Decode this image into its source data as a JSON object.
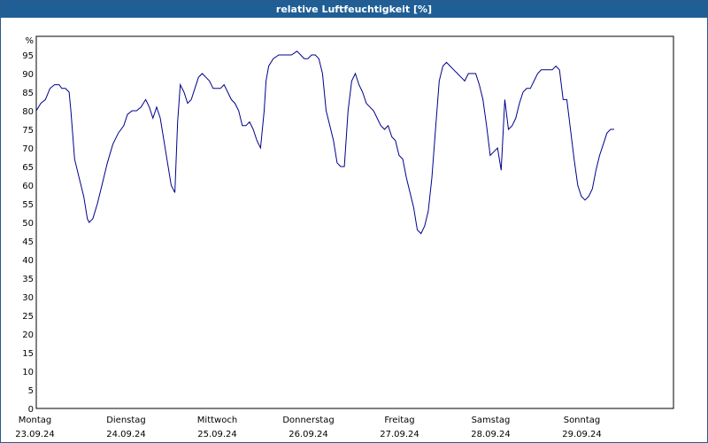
{
  "window": {
    "title": "relative Luftfeuchtigkeit [%]"
  },
  "chart_data": {
    "type": "line",
    "title": "relative Luftfeuchtigkeit [%]",
    "ylabel": "%",
    "xlabel": "",
    "ylim": [
      0,
      100
    ],
    "yticks": [
      0,
      5,
      10,
      15,
      20,
      25,
      30,
      35,
      40,
      45,
      50,
      55,
      60,
      65,
      70,
      75,
      80,
      85,
      90,
      95
    ],
    "grid": true,
    "line_color": "#00008b",
    "grid_color": "#000000",
    "xrange_days": [
      0,
      7
    ],
    "day_labels": [
      {
        "day": "Montag",
        "date": "23.09.24"
      },
      {
        "day": "Dienstag",
        "date": "24.09.24"
      },
      {
        "day": "Mittwoch",
        "date": "25.09.24"
      },
      {
        "day": "Donnerstag",
        "date": "26.09.24"
      },
      {
        "day": "Freitag",
        "date": "27.09.24"
      },
      {
        "day": "Samstag",
        "date": "28.09.24"
      },
      {
        "day": "Sonntag",
        "date": "29.09.24"
      }
    ],
    "series": [
      {
        "values": [
          [
            0.0,
            80
          ],
          [
            0.05,
            82
          ],
          [
            0.1,
            83
          ],
          [
            0.15,
            86
          ],
          [
            0.2,
            87
          ],
          [
            0.25,
            87
          ],
          [
            0.28,
            86
          ],
          [
            0.32,
            86
          ],
          [
            0.36,
            85
          ],
          [
            0.38,
            80
          ],
          [
            0.42,
            67
          ],
          [
            0.47,
            62
          ],
          [
            0.52,
            57
          ],
          [
            0.56,
            51
          ],
          [
            0.58,
            50
          ],
          [
            0.62,
            51
          ],
          [
            0.67,
            55
          ],
          [
            0.72,
            60
          ],
          [
            0.78,
            66
          ],
          [
            0.84,
            71
          ],
          [
            0.9,
            74
          ],
          [
            0.96,
            76
          ],
          [
            1.0,
            79
          ],
          [
            1.05,
            80
          ],
          [
            1.1,
            80
          ],
          [
            1.15,
            81
          ],
          [
            1.2,
            83
          ],
          [
            1.24,
            81
          ],
          [
            1.28,
            78
          ],
          [
            1.32,
            81
          ],
          [
            1.36,
            78
          ],
          [
            1.4,
            72
          ],
          [
            1.44,
            66
          ],
          [
            1.48,
            60
          ],
          [
            1.52,
            58
          ],
          [
            1.55,
            77
          ],
          [
            1.58,
            87
          ],
          [
            1.62,
            85
          ],
          [
            1.66,
            82
          ],
          [
            1.7,
            83
          ],
          [
            1.74,
            86
          ],
          [
            1.78,
            89
          ],
          [
            1.82,
            90
          ],
          [
            1.86,
            89
          ],
          [
            1.9,
            88
          ],
          [
            1.94,
            86
          ],
          [
            1.98,
            86
          ],
          [
            2.02,
            86
          ],
          [
            2.06,
            87
          ],
          [
            2.1,
            85
          ],
          [
            2.14,
            83
          ],
          [
            2.18,
            82
          ],
          [
            2.22,
            80
          ],
          [
            2.26,
            76
          ],
          [
            2.3,
            76
          ],
          [
            2.34,
            77
          ],
          [
            2.38,
            75
          ],
          [
            2.42,
            72
          ],
          [
            2.46,
            70
          ],
          [
            2.5,
            80
          ],
          [
            2.52,
            88
          ],
          [
            2.55,
            92
          ],
          [
            2.6,
            94
          ],
          [
            2.66,
            95
          ],
          [
            2.72,
            95
          ],
          [
            2.8,
            95
          ],
          [
            2.86,
            96
          ],
          [
            2.9,
            95
          ],
          [
            2.94,
            94
          ],
          [
            2.98,
            94
          ],
          [
            3.02,
            95
          ],
          [
            3.06,
            95
          ],
          [
            3.1,
            94
          ],
          [
            3.14,
            90
          ],
          [
            3.18,
            80
          ],
          [
            3.22,
            76
          ],
          [
            3.26,
            72
          ],
          [
            3.3,
            66
          ],
          [
            3.34,
            65
          ],
          [
            3.38,
            65
          ],
          [
            3.42,
            80
          ],
          [
            3.46,
            88
          ],
          [
            3.5,
            90
          ],
          [
            3.54,
            87
          ],
          [
            3.58,
            85
          ],
          [
            3.62,
            82
          ],
          [
            3.66,
            81
          ],
          [
            3.7,
            80
          ],
          [
            3.74,
            78
          ],
          [
            3.78,
            76
          ],
          [
            3.82,
            75
          ],
          [
            3.86,
            76
          ],
          [
            3.9,
            73
          ],
          [
            3.94,
            72
          ],
          [
            3.98,
            68
          ],
          [
            4.02,
            67
          ],
          [
            4.06,
            62
          ],
          [
            4.1,
            58
          ],
          [
            4.14,
            54
          ],
          [
            4.18,
            48
          ],
          [
            4.22,
            47
          ],
          [
            4.26,
            49
          ],
          [
            4.3,
            53
          ],
          [
            4.34,
            62
          ],
          [
            4.38,
            75
          ],
          [
            4.42,
            88
          ],
          [
            4.46,
            92
          ],
          [
            4.5,
            93
          ],
          [
            4.54,
            92
          ],
          [
            4.58,
            91
          ],
          [
            4.62,
            90
          ],
          [
            4.66,
            89
          ],
          [
            4.7,
            88
          ],
          [
            4.74,
            90
          ],
          [
            4.78,
            90
          ],
          [
            4.82,
            90
          ],
          [
            4.86,
            87
          ],
          [
            4.9,
            83
          ],
          [
            4.94,
            76
          ],
          [
            4.98,
            68
          ],
          [
            5.02,
            69
          ],
          [
            5.06,
            70
          ],
          [
            5.1,
            64
          ],
          [
            5.14,
            83
          ],
          [
            5.18,
            75
          ],
          [
            5.22,
            76
          ],
          [
            5.26,
            78
          ],
          [
            5.3,
            82
          ],
          [
            5.34,
            85
          ],
          [
            5.38,
            86
          ],
          [
            5.42,
            86
          ],
          [
            5.46,
            88
          ],
          [
            5.5,
            90
          ],
          [
            5.54,
            91
          ],
          [
            5.58,
            91
          ],
          [
            5.62,
            91
          ],
          [
            5.66,
            91
          ],
          [
            5.7,
            92
          ],
          [
            5.74,
            91
          ],
          [
            5.78,
            83
          ],
          [
            5.82,
            83
          ],
          [
            5.86,
            75
          ],
          [
            5.9,
            67
          ],
          [
            5.94,
            60
          ],
          [
            5.98,
            57
          ],
          [
            6.02,
            56
          ],
          [
            6.06,
            57
          ],
          [
            6.1,
            59
          ],
          [
            6.14,
            64
          ],
          [
            6.18,
            68
          ],
          [
            6.22,
            71
          ],
          [
            6.26,
            74
          ],
          [
            6.3,
            75
          ],
          [
            6.34,
            75
          ]
        ]
      }
    ]
  }
}
